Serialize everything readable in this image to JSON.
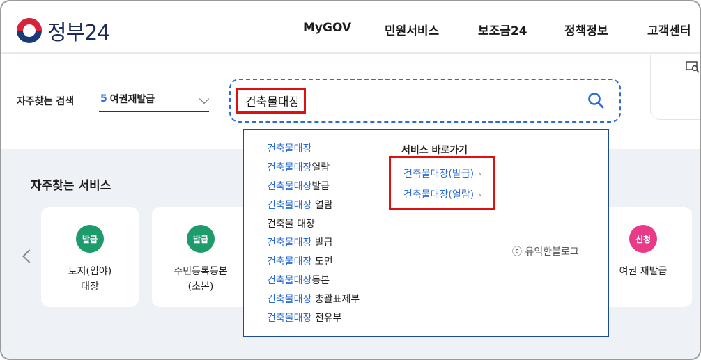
{
  "header": {
    "logo_text": "정부24",
    "nav": [
      "MyGOV",
      "민원서비스",
      "보조금24",
      "정책정보",
      "고객센터"
    ]
  },
  "search": {
    "faq_label": "자주찾는 검색",
    "faq_number": "5",
    "faq_value": "여권재발급",
    "query": "건축물대장"
  },
  "suggestions": [
    {
      "hl": "건축물대장",
      "rest": ""
    },
    {
      "hl": "건축물대장",
      "rest": "열람"
    },
    {
      "hl": "건축물대장",
      "rest": "발급"
    },
    {
      "hl": "건축물대장",
      "rest": " 열람"
    },
    {
      "hl": "",
      "rest": "건축물 대장"
    },
    {
      "hl": "건축물대장",
      "rest": " 발급"
    },
    {
      "hl": "건축물대장",
      "rest": " 도면"
    },
    {
      "hl": "건축물대장",
      "rest": "등본"
    },
    {
      "hl": "건축물대장",
      "rest": " 총괄표제부"
    },
    {
      "hl": "건축물대장",
      "rest": " 전유부"
    }
  ],
  "shortcuts": {
    "title": "서비스 바로가기",
    "items": [
      "건축물대장(발급)",
      "건축물대장(열람)"
    ]
  },
  "watermark": "ⓒ 유익한블로그",
  "services": {
    "title": "자주찾는 서비스",
    "cards": [
      {
        "badge": "발급",
        "line1": "토지(임야)",
        "line2": "대장",
        "color": "#1e9b6b"
      },
      {
        "badge": "발급",
        "line1": "주민등록등본",
        "line2": "(초본)",
        "color": "#1e9b6b"
      },
      {
        "badge": "신청",
        "line1": "여권 재발급",
        "line2": "",
        "color": "#ea3a87"
      }
    ]
  },
  "colors": {
    "accent_blue": "#2a6ad9",
    "highlight_red": "#e01010",
    "issue_green": "#1e9b6b",
    "apply_pink": "#ea3a87"
  }
}
